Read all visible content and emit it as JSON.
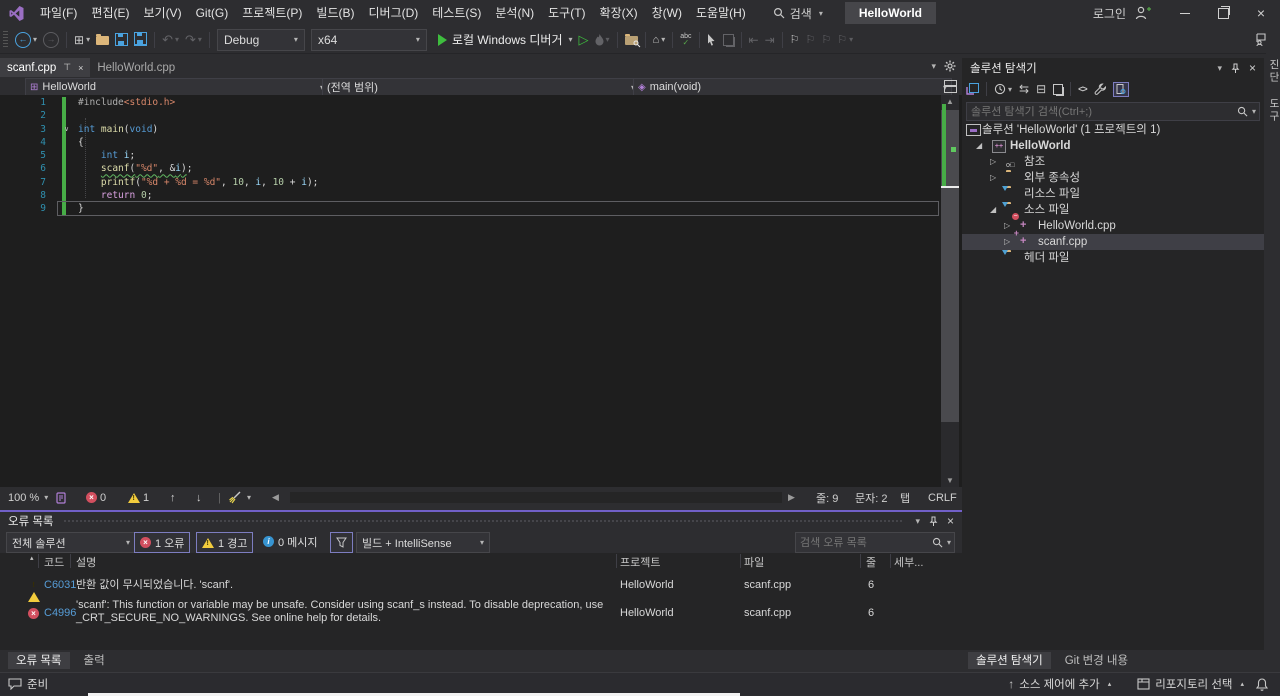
{
  "title_bar": {
    "menus": [
      "파일(F)",
      "편집(E)",
      "보기(V)",
      "Git(G)",
      "프로젝트(P)",
      "빌드(B)",
      "디버그(D)",
      "테스트(S)",
      "분석(N)",
      "도구(T)",
      "확장(X)",
      "창(W)",
      "도움말(H)"
    ],
    "search_label": "검색",
    "solution_badge": "HelloWorld",
    "sign_in_label": "로그인"
  },
  "toolbar": {
    "configuration": "Debug",
    "platform": "x64",
    "debug_target": "로컬 Windows 디버거"
  },
  "editor": {
    "tabs": [
      {
        "label": "scanf.cpp",
        "active": true
      },
      {
        "label": "HelloWorld.cpp",
        "active": false
      }
    ],
    "navigation": {
      "project": "HelloWorld",
      "scope": "(전역 범위)",
      "member": "main(void)"
    },
    "code": {
      "lines": [
        {
          "n": "1",
          "tokens": [
            [
              "pp",
              "#include"
            ],
            [
              "str",
              "<stdio.h>"
            ]
          ]
        },
        {
          "n": "2",
          "tokens": []
        },
        {
          "n": "3",
          "fold": true,
          "tokens": [
            [
              "kw",
              "int"
            ],
            [
              "pl",
              " "
            ],
            [
              "fn",
              "main"
            ],
            [
              "pl",
              "("
            ],
            [
              "kw",
              "void"
            ],
            [
              "pl",
              ")"
            ]
          ]
        },
        {
          "n": "4",
          "tokens": [
            [
              "pl",
              "{"
            ]
          ]
        },
        {
          "n": "5",
          "tokens": [
            [
              "pl",
              "    "
            ],
            [
              "kw",
              "int"
            ],
            [
              "pl",
              " "
            ],
            [
              "var",
              "i"
            ],
            [
              "pl",
              ";"
            ]
          ]
        },
        {
          "n": "6",
          "tokens": [
            [
              "pl",
              "    "
            ],
            [
              "fn sq",
              "scanf"
            ],
            [
              "pl sq",
              "("
            ],
            [
              "str sq",
              "\"%d\""
            ],
            [
              "pl sq",
              ", &"
            ],
            [
              "var sq",
              "i"
            ],
            [
              "pl sq",
              ")"
            ],
            [
              "pl",
              ";"
            ]
          ]
        },
        {
          "n": "7",
          "tokens": [
            [
              "pl",
              "    "
            ],
            [
              "fn",
              "printf"
            ],
            [
              "pl",
              "("
            ],
            [
              "str",
              "\"%d + %d = %d\""
            ],
            [
              "pl",
              ", "
            ],
            [
              "num",
              "10"
            ],
            [
              "pl",
              ", "
            ],
            [
              "var",
              "i"
            ],
            [
              "pl",
              ", "
            ],
            [
              "num",
              "10"
            ],
            [
              "pl",
              " + "
            ],
            [
              "var",
              "i"
            ],
            [
              "pl",
              ");"
            ]
          ]
        },
        {
          "n": "8",
          "tokens": [
            [
              "pl",
              "    "
            ],
            [
              "ctrl",
              "return"
            ],
            [
              "pl",
              " "
            ],
            [
              "num",
              "0"
            ],
            [
              "pl",
              ";"
            ]
          ]
        },
        {
          "n": "9",
          "current": true,
          "tokens": [
            [
              "pl",
              "}"
            ]
          ]
        }
      ]
    },
    "status_bar": {
      "zoom": "100 %",
      "error_count": "0",
      "warning_count": "1",
      "line": "줄: 9",
      "column": "문자: 2",
      "tabs_mode": "탭",
      "line_ending": "CRLF"
    }
  },
  "error_list": {
    "title": "오류 목록",
    "scope_filter": "전체 솔루션",
    "error_toggle": "1 오류",
    "warning_toggle": "1 경고",
    "message_toggle": "0 메시지",
    "source_filter": "빌드 + IntelliSense",
    "search_placeholder": "검색 오류 목록",
    "columns": [
      "코드",
      "설명",
      "프로젝트",
      "파일",
      "줄",
      "세부..."
    ],
    "rows": [
      {
        "severity": "warning",
        "code": "C6031",
        "description": "반환 값이 무시되었습니다. 'scanf'.",
        "project": "HelloWorld",
        "file": "scanf.cpp",
        "line": "6"
      },
      {
        "severity": "error",
        "code": "C4996",
        "description": "'scanf': This function or variable may be unsafe. Consider using scanf_s instead. To disable deprecation, use _CRT_SECURE_NO_WARNINGS. See online help for details.",
        "project": "HelloWorld",
        "file": "scanf.cpp",
        "line": "6"
      }
    ]
  },
  "solution_explorer": {
    "title": "솔루션 탐색기",
    "search_placeholder": "솔루션 탐색기 검색(Ctrl+;)",
    "tree": [
      {
        "depth": 0,
        "arrow": "none",
        "icon": "solution",
        "label": "솔루션 'HelloWorld' (1 프로젝트의 1)"
      },
      {
        "depth": 1,
        "arrow": "open",
        "icon": "project",
        "label": "HelloWorld",
        "bold": true
      },
      {
        "depth": 2,
        "arrow": "closed",
        "icon": "refs",
        "label": "참조"
      },
      {
        "depth": 2,
        "arrow": "closed",
        "icon": "deps",
        "label": "외부 종속성"
      },
      {
        "depth": 2,
        "arrow": "none",
        "icon": "folder",
        "label": "리소스 파일"
      },
      {
        "depth": 2,
        "arrow": "open",
        "icon": "folder",
        "label": "소스 파일"
      },
      {
        "depth": 3,
        "arrow": "closed",
        "icon": "cpp-mod",
        "label": "HelloWorld.cpp"
      },
      {
        "depth": 3,
        "arrow": "closed",
        "icon": "cpp-add",
        "label": "scanf.cpp",
        "selected": true
      },
      {
        "depth": 2,
        "arrow": "none",
        "icon": "folder",
        "label": "헤더 파일"
      }
    ],
    "panel_tabs": [
      {
        "label": "솔루션 탐색기",
        "active": true
      },
      {
        "label": "Git 변경 내용",
        "active": false
      }
    ]
  },
  "bottom_panel_tabs": [
    {
      "label": "오류 목록",
      "active": true
    },
    {
      "label": "출력",
      "active": false
    }
  ],
  "status_bar": {
    "message": "준비",
    "add_source_control": "소스 제어에 추가",
    "select_repository": "리포지토리 선택"
  },
  "right_edge": {
    "vertical_tab": "진단 도구"
  },
  "icons": {
    "vs-logo": "purple infinity mark",
    "search": "magnifier",
    "pin": "pushpin",
    "close": "x-cross",
    "gear": "settings gear",
    "error": "red circle with x",
    "warning": "yellow triangle with !",
    "info": "blue circle with i",
    "play": "green triangle",
    "save": "blue floppy",
    "folder": "yellow folder with filter funnel",
    "bell": "notification bell"
  },
  "accent_colors": {
    "focus_accent": "#7160c8",
    "change_bar_green": "#47ad47",
    "play_green": "#3ebd3e",
    "line_number_teal": "#2f8fae"
  }
}
